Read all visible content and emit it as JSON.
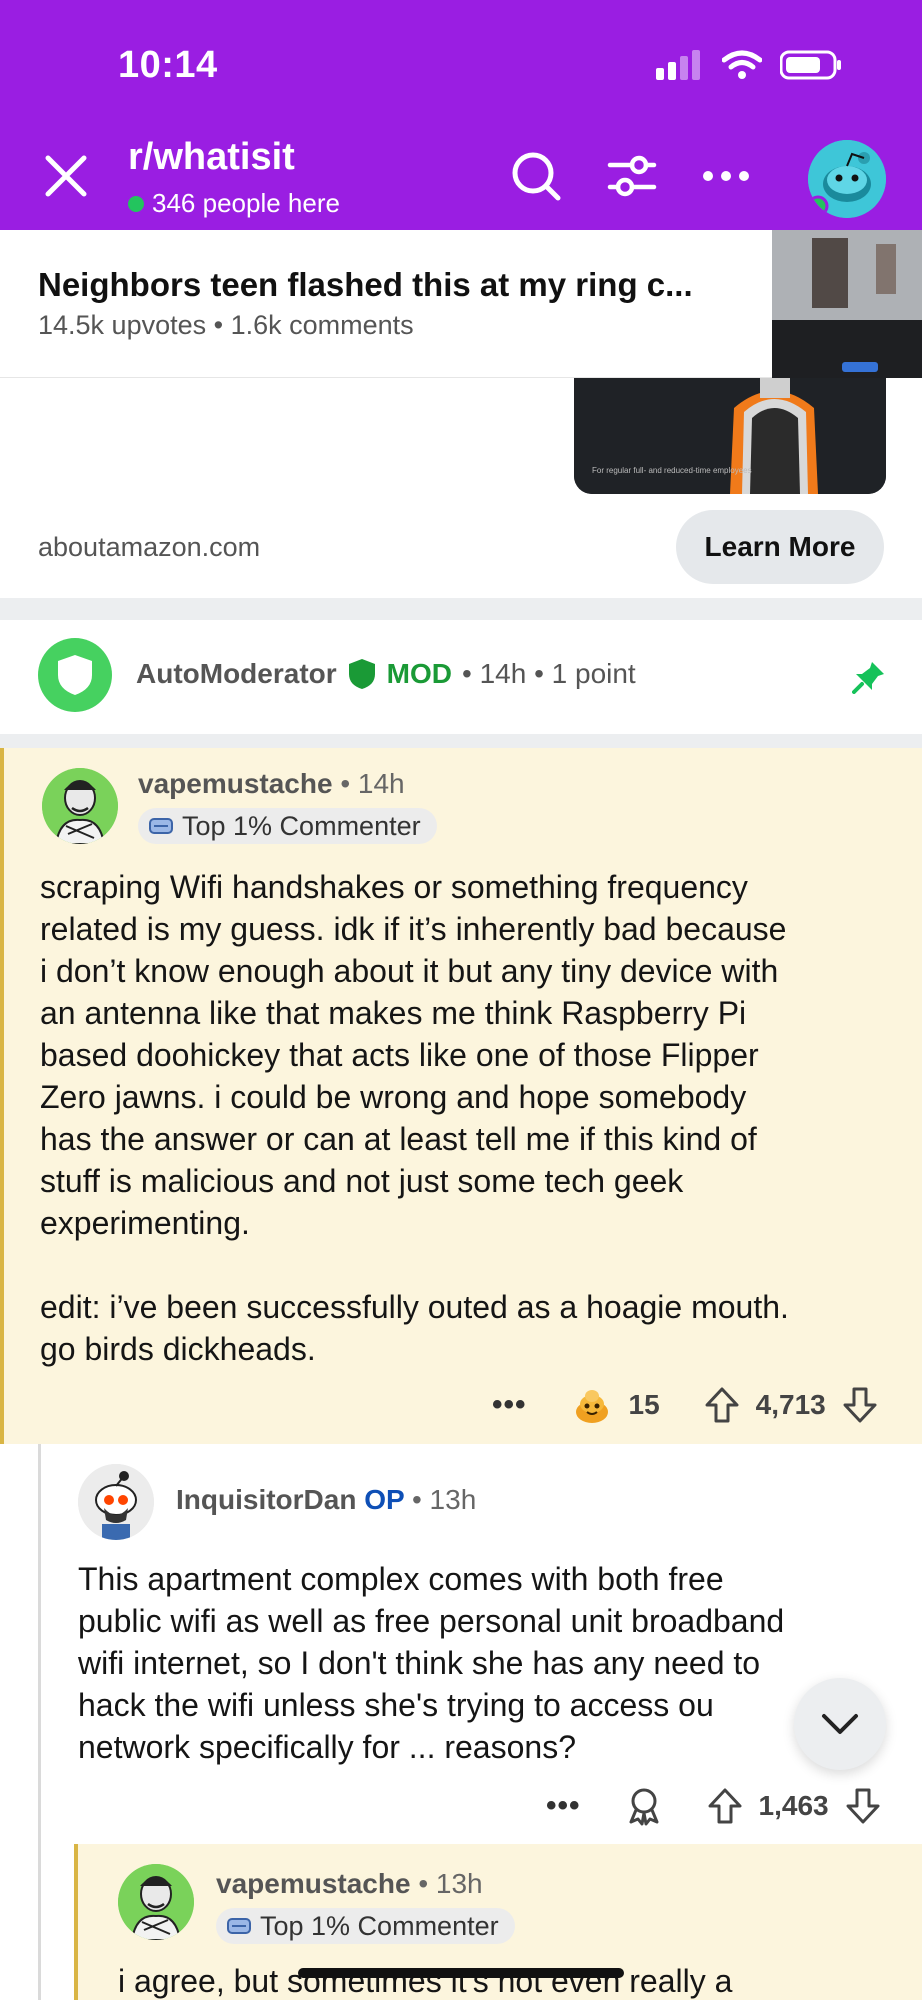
{
  "status_bar": {
    "time": "10:14"
  },
  "header": {
    "subreddit": "r/whatisit",
    "online_text": "346 people here"
  },
  "post": {
    "title": "Neighbors teen flashed this at my ring c...",
    "meta": "14.5k upvotes • 1.6k comments"
  },
  "ad": {
    "caption": "For regular full- and reduced-time employees",
    "domain": "aboutamazon.com",
    "cta": "Learn More"
  },
  "automod": {
    "name": "AutoModerator",
    "mod_label": "MOD",
    "meta": "• 14h • 1 point"
  },
  "comments": [
    {
      "user": "vapemustache",
      "time": "• 14h",
      "badge": "Top 1% Commenter",
      "body_lines": [
        "scraping Wifi handshakes or something frequency",
        "related is my guess. idk if it’s inherently bad because",
        "i don’t know enough about it but any tiny device with",
        "an antenna like that makes me think Raspberry Pi",
        "based doohickey that acts like one of those Flipper",
        "Zero jawns. i could be wrong and hope somebody",
        "has the answer or can at least tell me if this kind of",
        "stuff is malicious and not just some tech geek",
        "experimenting.",
        "",
        "edit: i’ve been successfully outed as a hoagie mouth.",
        "go birds dickheads."
      ],
      "award_count": "15",
      "score": "4,713"
    },
    {
      "user": "InquisitorDan",
      "op_label": "OP",
      "time": "• 13h",
      "body_lines": [
        "This apartment complex comes with both free",
        "public wifi as well as free personal unit broadband",
        "wifi internet, so I don't think she has any need to",
        "hack the wifi unless she's trying to access ou",
        "network specifically for ... reasons?"
      ],
      "score": "1,463"
    },
    {
      "user": "vapemustache",
      "time": "• 13h",
      "badge": "Top 1% Commenter",
      "body_lines": [
        "i agree, but sometimes it's not even really a"
      ]
    }
  ],
  "actions": {
    "more_label": "•••"
  },
  "colors": {
    "header_bg": "#9a1ee2",
    "highlight_bg": "#fcf5dd",
    "mod_green": "#1a9a36",
    "op_blue": "#0e4fb6"
  },
  "icons": [
    "close-icon",
    "search-icon",
    "filter-icon",
    "more-icon",
    "avatar",
    "shield-icon",
    "pin-icon",
    "upvote-icon",
    "downvote-icon",
    "award-icon",
    "chevron-down-icon"
  ]
}
